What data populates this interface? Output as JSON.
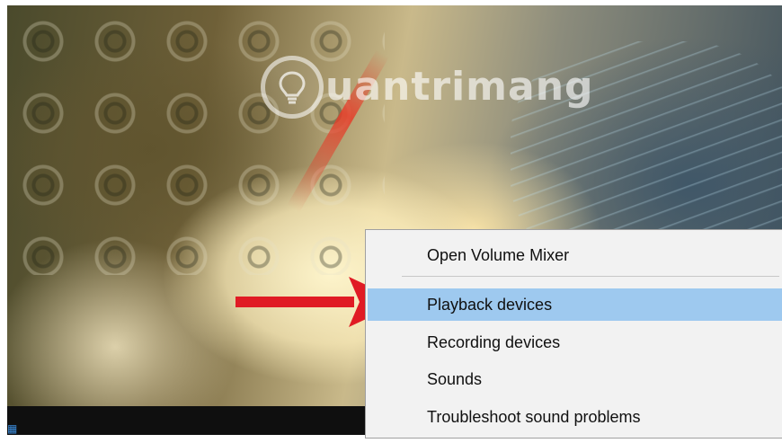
{
  "wallpaper": {
    "watermark_text": "uantrimang",
    "watermark_icon": "lightbulb-icon"
  },
  "context_menu": {
    "items": [
      {
        "label": "Open Volume Mixer"
      },
      {
        "label": "Playback devices",
        "selected": true
      },
      {
        "label": "Recording devices"
      },
      {
        "label": "Sounds"
      },
      {
        "label": "Troubleshoot sound problems"
      }
    ],
    "highlight_color": "#9ec9ef"
  },
  "annotation": {
    "arrow_color": "#e01b24",
    "arrow_icon": "right-arrow-icon"
  },
  "taskbar": {
    "icon": "start-icon"
  }
}
